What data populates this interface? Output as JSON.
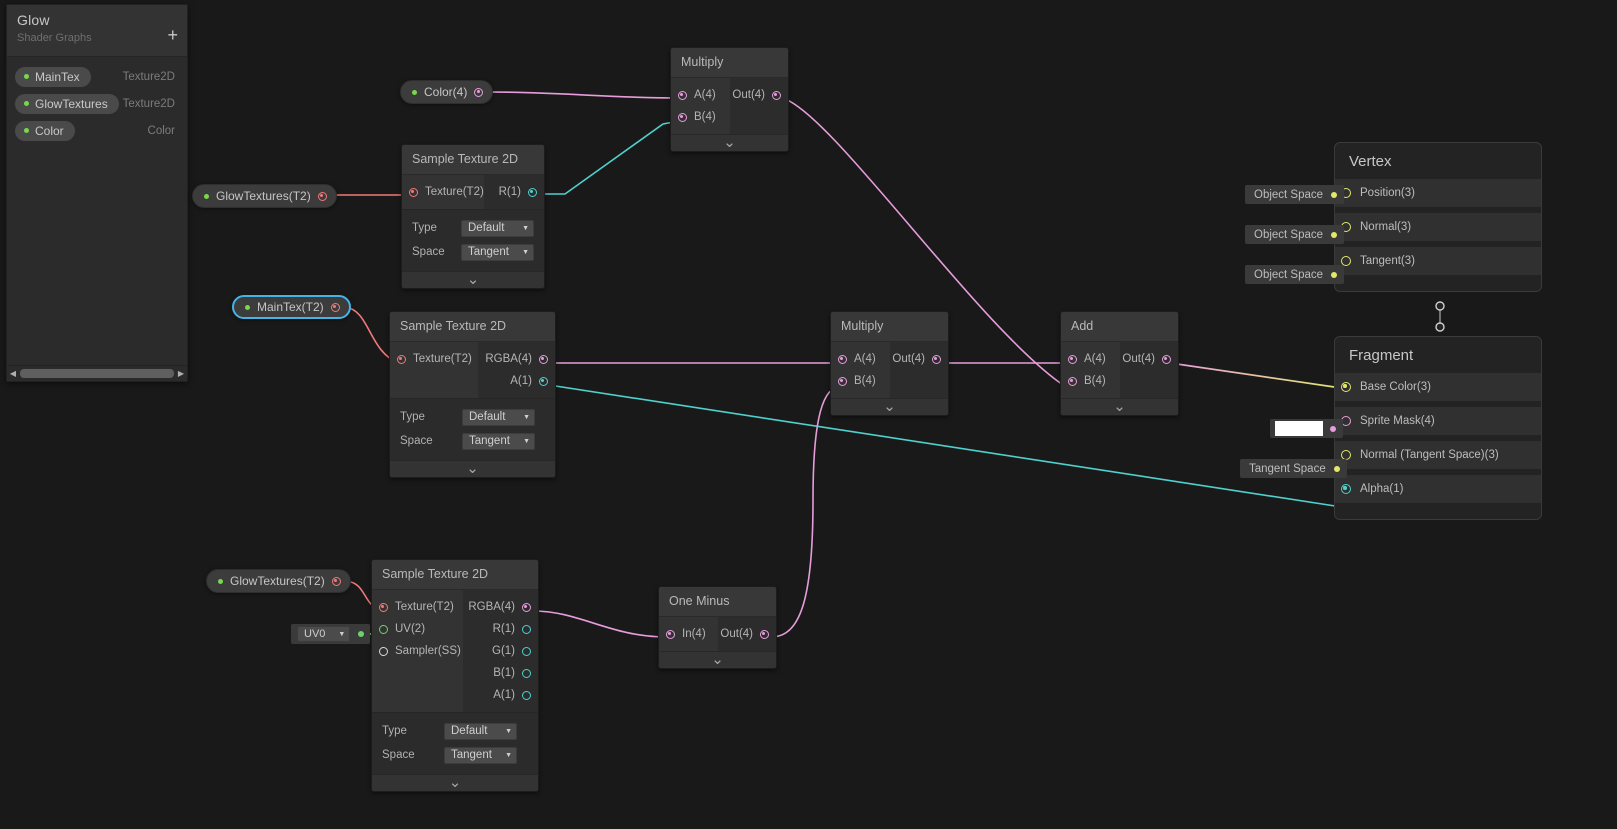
{
  "blackboard": {
    "title": "Glow",
    "subtitle": "Shader Graphs",
    "add_label": "+",
    "properties": [
      {
        "name": "MainTex",
        "type": "Texture2D"
      },
      {
        "name": "GlowTextures",
        "type": "Texture2D"
      },
      {
        "name": "Color",
        "type": "Color"
      }
    ]
  },
  "property_nodes": [
    {
      "label": "GlowTextures(T2)",
      "selected": false
    },
    {
      "label": "MainTex(T2)",
      "selected": true
    },
    {
      "label": "GlowTextures(T2)",
      "selected": false
    },
    {
      "label": "Color(4)",
      "selected": false
    }
  ],
  "nodes": {
    "multiply_top": {
      "title": "Multiply",
      "inputs": [
        "A(4)",
        "B(4)"
      ],
      "outputs": [
        "Out(4)"
      ]
    },
    "sample_tex_top": {
      "title": "Sample Texture 2D",
      "inputs": [
        "Texture(T2)"
      ],
      "outputs": [
        "R(1)"
      ],
      "settings": [
        {
          "label": "Type",
          "value": "Default"
        },
        {
          "label": "Space",
          "value": "Tangent"
        }
      ]
    },
    "sample_tex_mid": {
      "title": "Sample Texture 2D",
      "inputs": [
        "Texture(T2)"
      ],
      "outputs": [
        "RGBA(4)",
        "A(1)"
      ],
      "settings": [
        {
          "label": "Type",
          "value": "Default"
        },
        {
          "label": "Space",
          "value": "Tangent"
        }
      ]
    },
    "sample_tex_bottom": {
      "title": "Sample Texture 2D",
      "inputs": [
        "Texture(T2)",
        "UV(2)",
        "Sampler(SS)"
      ],
      "outputs": [
        "RGBA(4)",
        "R(1)",
        "G(1)",
        "B(1)",
        "A(1)"
      ],
      "settings": [
        {
          "label": "Type",
          "value": "Default"
        },
        {
          "label": "Space",
          "value": "Tangent"
        }
      ]
    },
    "multiply_mid": {
      "title": "Multiply",
      "inputs": [
        "A(4)",
        "B(4)"
      ],
      "outputs": [
        "Out(4)"
      ]
    },
    "add": {
      "title": "Add",
      "inputs": [
        "A(4)",
        "B(4)"
      ],
      "outputs": [
        "Out(4)"
      ]
    },
    "one_minus": {
      "title": "One Minus",
      "inputs": [
        "In(4)"
      ],
      "outputs": [
        "Out(4)"
      ]
    }
  },
  "uv_node": {
    "value": "UV0"
  },
  "vertex": {
    "title": "Vertex",
    "rows": [
      {
        "label": "Position(3)",
        "space": "Object Space"
      },
      {
        "label": "Normal(3)",
        "space": "Object Space"
      },
      {
        "label": "Tangent(3)",
        "space": "Object Space"
      }
    ]
  },
  "fragment": {
    "title": "Fragment",
    "rows": [
      {
        "label": "Base Color(3)",
        "space": ""
      },
      {
        "label": "Sprite Mask(4)",
        "space": "",
        "swatch": "#ffffff"
      },
      {
        "label": "Normal (Tangent Space)(3)",
        "space": "Tangent Space"
      },
      {
        "label": "Alpha(1)",
        "space": ""
      }
    ]
  },
  "colors": {
    "wire_pink": "#e79ddb",
    "wire_red": "#f07a78",
    "wire_teal": "#4fd2cd",
    "wire_green": "#6bd36b",
    "wire_yellow": "#e3e86a",
    "accent_select": "#44b4e8",
    "property_dot": "#77d94a"
  }
}
